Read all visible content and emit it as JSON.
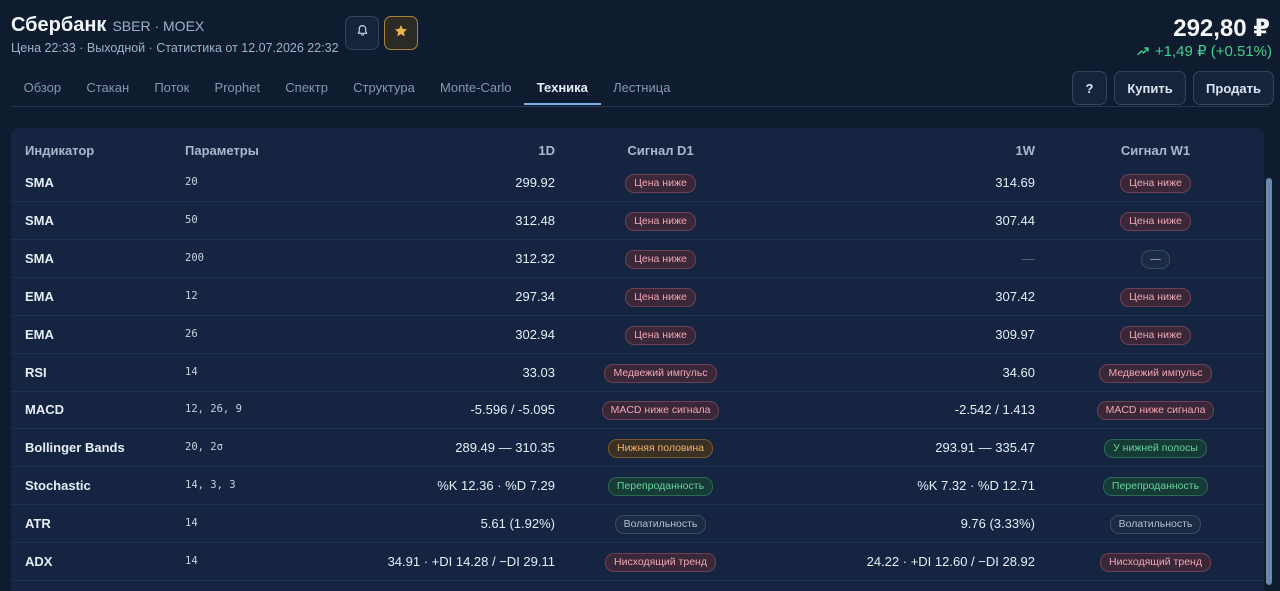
{
  "header": {
    "company": "Сбербанк",
    "ticker": "SBER · MOEX",
    "subline": "Цена 22:33 · Выходной · Статистика от 12.07.2026 22:32",
    "price": "292,80 ₽",
    "change": "+1,49 ₽ (+0.51%)",
    "bell_icon": "bell-icon",
    "star_icon": "star-icon"
  },
  "tabs": [
    {
      "label": "Обзор"
    },
    {
      "label": "Стакан"
    },
    {
      "label": "Поток"
    },
    {
      "label": "Prophet"
    },
    {
      "label": "Спектр"
    },
    {
      "label": "Структура"
    },
    {
      "label": "Monte-Carlo"
    },
    {
      "label": "Техника",
      "active": true
    },
    {
      "label": "Лестница"
    }
  ],
  "actions": {
    "help": "?",
    "buy": "Купить",
    "sell": "Продать"
  },
  "table": {
    "headers": {
      "indicator": "Индикатор",
      "params": "Параметры",
      "d1": "1D",
      "sig_d1": "Сигнал D1",
      "w1": "1W",
      "sig_w1": "Сигнал W1"
    },
    "rows": [
      {
        "ind": "SMA",
        "params": "20",
        "d1": "299.92",
        "sig1": "Цена ниже",
        "sig1_tone": "red",
        "w1": "314.69",
        "sig2": "Цена ниже",
        "sig2_tone": "red"
      },
      {
        "ind": "SMA",
        "params": "50",
        "d1": "312.48",
        "sig1": "Цена ниже",
        "sig1_tone": "red",
        "w1": "307.44",
        "sig2": "Цена ниже",
        "sig2_tone": "red"
      },
      {
        "ind": "SMA",
        "params": "200",
        "d1": "312.32",
        "sig1": "Цена ниже",
        "sig1_tone": "red",
        "w1": "—",
        "sig2": "—",
        "sig2_tone": "neutral"
      },
      {
        "ind": "EMA",
        "params": "12",
        "d1": "297.34",
        "sig1": "Цена ниже",
        "sig1_tone": "red",
        "w1": "307.42",
        "sig2": "Цена ниже",
        "sig2_tone": "red"
      },
      {
        "ind": "EMA",
        "params": "26",
        "d1": "302.94",
        "sig1": "Цена ниже",
        "sig1_tone": "red",
        "w1": "309.97",
        "sig2": "Цена ниже",
        "sig2_tone": "red"
      },
      {
        "ind": "RSI",
        "params": "14",
        "d1": "33.03",
        "sig1": "Медвежий импульс",
        "sig1_tone": "red",
        "w1": "34.60",
        "sig2": "Медвежий импульс",
        "sig2_tone": "red"
      },
      {
        "ind": "MACD",
        "params": "12, 26, 9",
        "d1": "-5.596 / -5.095",
        "sig1": "MACD ниже сигнала",
        "sig1_tone": "red",
        "w1": "-2.542 / 1.413",
        "sig2": "MACD ниже сигнала",
        "sig2_tone": "red"
      },
      {
        "ind": "Bollinger Bands",
        "params": "20, 2σ",
        "d1": "289.49 — 310.35",
        "sig1": "Нижняя половина",
        "sig1_tone": "orange",
        "w1": "293.91 — 335.47",
        "sig2": "У нижней полосы",
        "sig2_tone": "green"
      },
      {
        "ind": "Stochastic",
        "params": "14, 3, 3",
        "d1": "%K 12.36 · %D 7.29",
        "sig1": "Перепроданность",
        "sig1_tone": "green",
        "w1": "%K 7.32 · %D 12.71",
        "sig2": "Перепроданность",
        "sig2_tone": "green"
      },
      {
        "ind": "ATR",
        "params": "14",
        "d1": "5.61 (1.92%)",
        "sig1": "Волатильность",
        "sig1_tone": "neutral",
        "w1": "9.76 (3.33%)",
        "sig2": "Волатильность",
        "sig2_tone": "neutral"
      },
      {
        "ind": "ADX",
        "params": "14",
        "d1": "34.91 · +DI 14.28 / −DI 29.11",
        "sig1": "Нисходящий тренд",
        "sig1_tone": "red",
        "w1": "24.22 · +DI 12.60 / −DI 28.92",
        "sig2": "Нисходящий тренд",
        "sig2_tone": "red"
      }
    ]
  },
  "colors": {
    "background": "#0f1b2f",
    "panel": "#152541",
    "positive": "#3fcf8e",
    "negative_badge": "#f0a6b4",
    "warning_badge": "#f1b46b",
    "accent_tab": "#7fb1e6",
    "star": "#e8b54a"
  }
}
